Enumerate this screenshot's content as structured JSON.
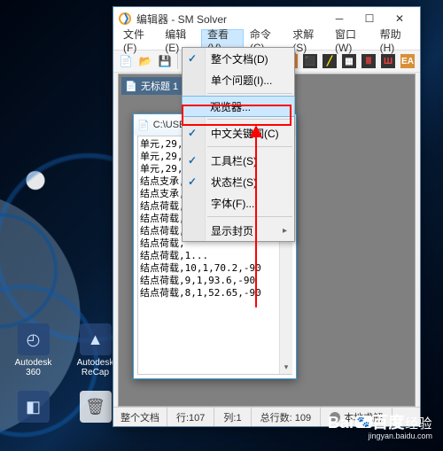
{
  "app": {
    "title": "编辑器 - SM Solver"
  },
  "menubar": {
    "file": "文件(F)",
    "edit": "编辑(E)",
    "view": "查看(V)",
    "command": "命令(C)",
    "solve": "求解(S)",
    "window": "窗口(W)",
    "help": "帮助(H)"
  },
  "dropdown": {
    "whole_doc": "整个文档(D)",
    "single_question": "单个问题(I)...",
    "viewer": "观览器...",
    "chinese_kw": "中文关键词(C)",
    "toolbar": "工具栏(S)",
    "statusbar": "状态栏(S)",
    "font": "字体(F)...",
    "show_cover": "显示封页"
  },
  "doc_tab": "无标题 1",
  "sub_window": {
    "title": "C:\\USER...",
    "lines": [
      "单元,29,7,2",
      "单元,29,26",
      "单元,29,6,",
      "结点支承,",
      "结点支承,",
      "结点荷载,",
      "结点荷载,",
      "结点荷载,",
      "结点荷载,",
      "结点荷载,1...",
      "结点荷载,10,1,70.2,-90",
      "结点荷载,9,1,93.6,-90",
      "结点荷载,8,1,52.65,-90"
    ]
  },
  "statusbar": {
    "scope": "整个文档",
    "row": "行:107",
    "col": "列:1",
    "total": "总行数: 109",
    "mode": "本地求解"
  },
  "desktop": {
    "icon1": "Autodesk 360",
    "icon2": "Autodesk ReCap"
  },
  "watermark": {
    "brand": "Bai",
    "brand2": "百度",
    "suffix": "经验",
    "url": "jingyan.baidu.com"
  }
}
